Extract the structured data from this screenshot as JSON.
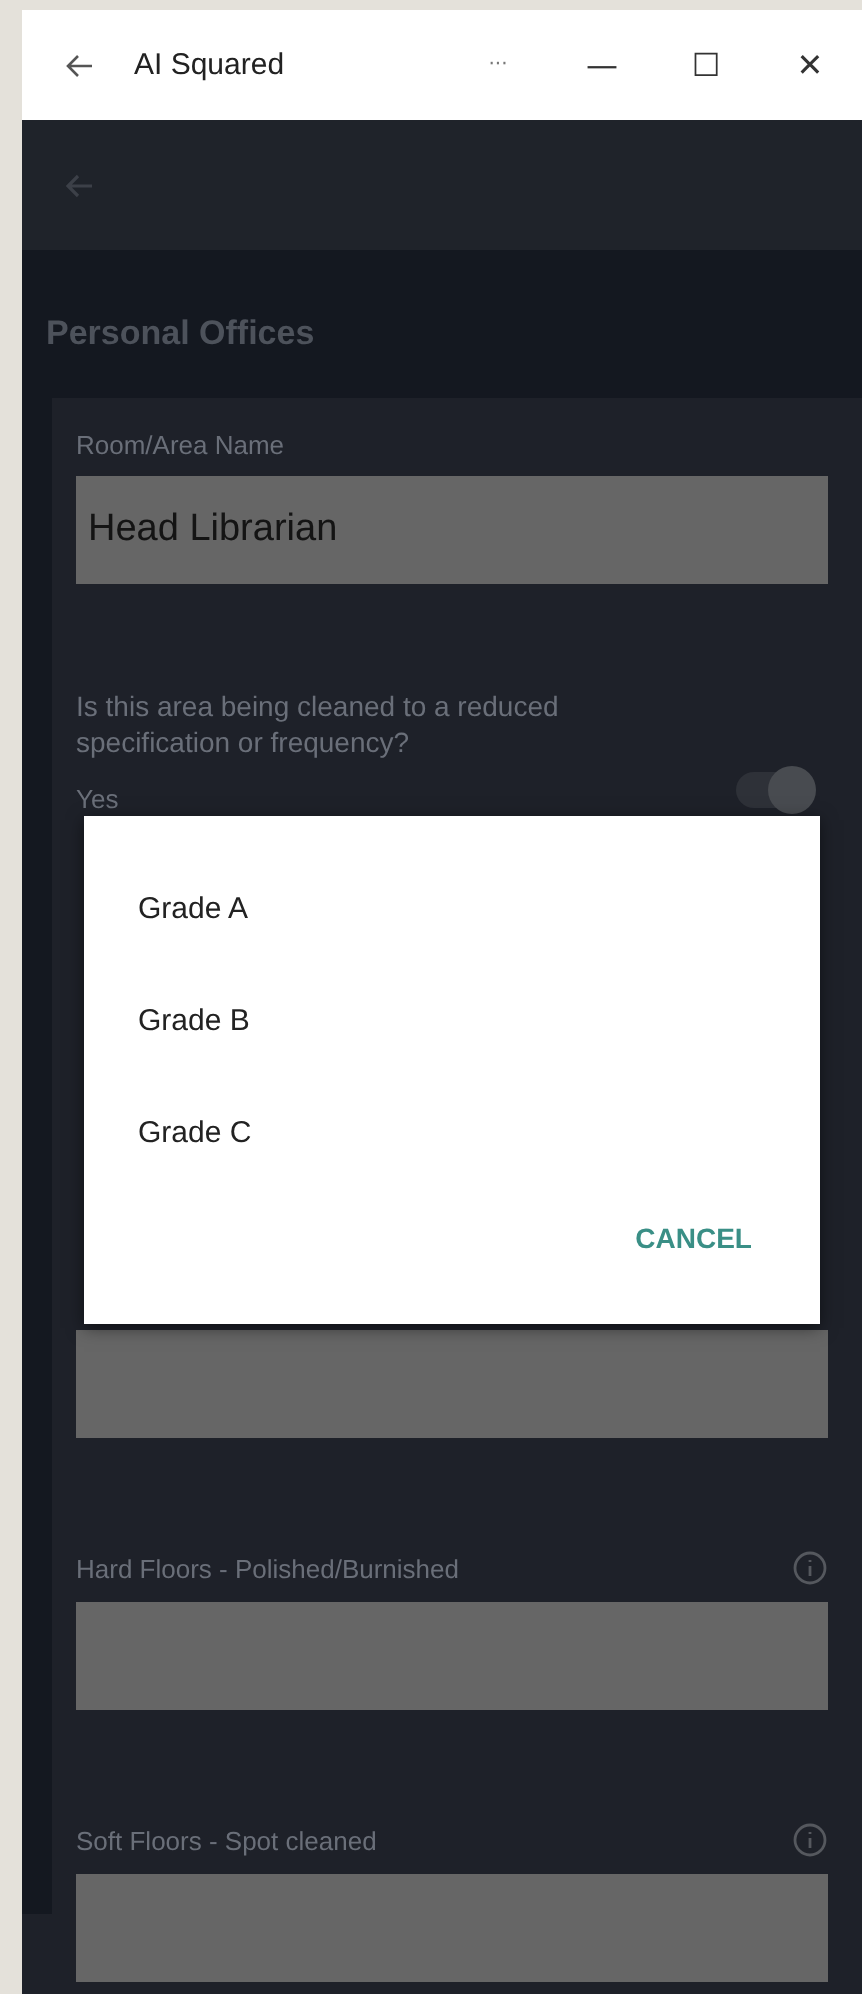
{
  "window": {
    "title": "AI Squared",
    "controls": [
      "···",
      "—",
      "☐",
      "✕"
    ]
  },
  "page": {
    "title": "Personal Offices"
  },
  "form": {
    "name_label": "Room/Area Name",
    "name_value": "Head Librarian",
    "question": "Is this area being cleaned to a reduced specification or frequency?",
    "answer": "Yes",
    "toggle_on": true,
    "fields": [
      {
        "label": "Hard Floors - Polished/Burnished"
      },
      {
        "label": "Soft Floors - Spot cleaned"
      }
    ]
  },
  "dialog": {
    "options": [
      {
        "label": "Grade A"
      },
      {
        "label": "Grade B"
      },
      {
        "label": "Grade C"
      }
    ],
    "cancel": "CANCEL"
  }
}
